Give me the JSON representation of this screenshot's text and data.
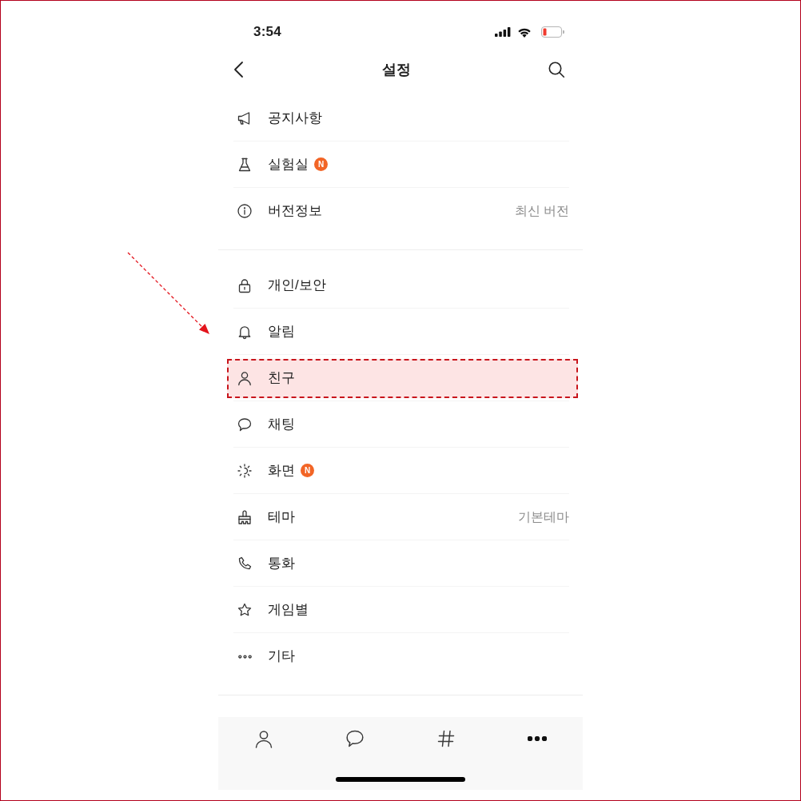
{
  "status_bar": {
    "time": "3:54"
  },
  "header": {
    "title": "설정"
  },
  "sections": [
    {
      "items": [
        {
          "label": "공지사항",
          "highlighted": false
        },
        {
          "label": "실험실",
          "badge": "N",
          "highlighted": false
        },
        {
          "label": "버전정보",
          "value": "최신 버전",
          "highlighted": false
        }
      ]
    },
    {
      "items": [
        {
          "label": "개인/보안",
          "highlighted": false
        },
        {
          "label": "알림",
          "highlighted": false
        },
        {
          "label": "친구",
          "highlighted": true
        },
        {
          "label": "채팅",
          "highlighted": false
        },
        {
          "label": "화면",
          "badge": "N",
          "highlighted": false
        },
        {
          "label": "테마",
          "value": "기본테마",
          "highlighted": false
        },
        {
          "label": "통화",
          "highlighted": false
        },
        {
          "label": "게임별",
          "highlighted": false
        },
        {
          "label": "기타",
          "highlighted": false
        }
      ]
    }
  ],
  "tab_bar": {
    "tabs": [
      {
        "selected": false
      },
      {
        "selected": false
      },
      {
        "selected": false
      },
      {
        "selected": true
      }
    ]
  }
}
